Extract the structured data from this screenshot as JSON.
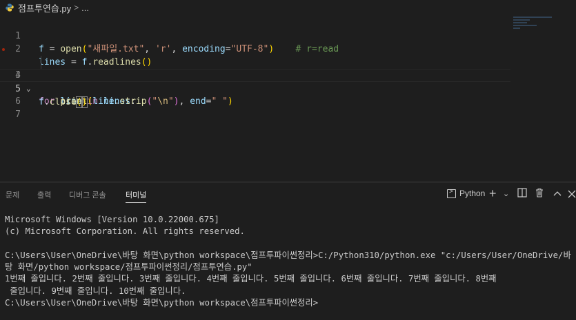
{
  "breadcrumb": {
    "file": "점프투연습.py",
    "chevron": ">",
    "ellipsis": "..."
  },
  "editor": {
    "line_numbers": [
      "1",
      "2",
      "3",
      "4",
      "5",
      "6",
      "7"
    ],
    "comment": "# r=read"
  },
  "panel": {
    "tabs": [
      {
        "label": "문제"
      },
      {
        "label": "출력"
      },
      {
        "label": "디버그 콘솔"
      },
      {
        "label": "터미널"
      }
    ],
    "terminal_name": "Python"
  },
  "terminal": {
    "lines": [
      "Microsoft Windows [Version 10.0.22000.675]",
      "(c) Microsoft Corporation. All rights reserved.",
      "",
      "C:\\Users\\User\\OneDrive\\바탕 화면\\python workspace\\점프투파이썬정리>C:/Python310/python.exe \"c:/Users/User/OneDrive/바",
      "탕 화면/python workspace/점프투파이썬정리/점프투연습.py\"",
      "1번째 줄입니다. 2번째 줄입니다. 3번째 줄입니다. 4번째 줄입니다. 5번째 줄입니다. 6번째 줄입니다. 7번째 줄입니다. 8번째",
      " 줄입니다. 9번째 줄입니다. 10번째 줄입니다.",
      "C:\\Users\\User\\OneDrive\\바탕 화면\\python workspace\\점프투파이썬정리>"
    ]
  }
}
